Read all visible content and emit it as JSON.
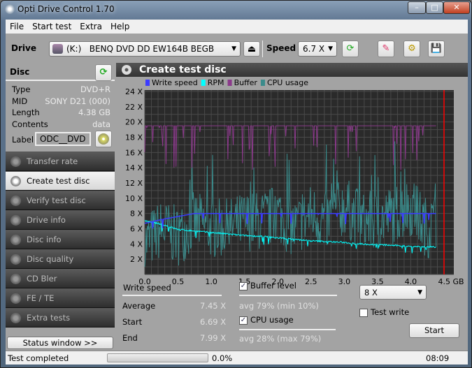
{
  "window": {
    "title": "Opti Drive Control 1.70",
    "min": "–",
    "max": "□",
    "close": "✕"
  },
  "menu": [
    "File",
    "Start test",
    "Extra",
    "Help"
  ],
  "toolbar": {
    "drive_label": "Drive",
    "drive_letter": "(K:)",
    "drive_name": "BENQ DVD DD EW164B BEGB",
    "speed_label": "Speed",
    "speed_value": "6.7 X"
  },
  "disc": {
    "title": "Disc",
    "rows": [
      {
        "k": "Type",
        "v": "DVD+R"
      },
      {
        "k": "MID",
        "v": "SONY D21 (000)"
      },
      {
        "k": "Length",
        "v": "4.38 GB"
      },
      {
        "k": "Contents",
        "v": "data"
      }
    ],
    "label_key": "Label",
    "label_value": "ODC__DVD"
  },
  "nav": [
    {
      "label": "Transfer rate"
    },
    {
      "label": "Create test disc",
      "selected": true
    },
    {
      "label": "Verify test disc"
    },
    {
      "label": "Drive info"
    },
    {
      "label": "Disc info"
    },
    {
      "label": "Disc quality"
    },
    {
      "label": "CD Bler"
    },
    {
      "label": "FE / TE"
    },
    {
      "label": "Extra tests"
    }
  ],
  "status_window_button": "Status window >>",
  "panel_title": "Create test disc",
  "chart_data": {
    "type": "line",
    "legend": [
      {
        "name": "Write speed",
        "color": "#3b3bff"
      },
      {
        "name": "RPM",
        "color": "#00ffff"
      },
      {
        "name": "Buffer",
        "color": "#8b3a8b"
      },
      {
        "name": "CPU usage",
        "color": "#3a8b8b"
      }
    ],
    "legend_placement": "top",
    "x_ticks": [
      "0.0",
      "0.5",
      "1.0",
      "1.5",
      "2.0",
      "2.5",
      "3.0",
      "3.5",
      "4.0",
      "4.5 GB"
    ],
    "y_ticks": [
      "2 X",
      "4 X",
      "6 X",
      "8 X",
      "10 X",
      "12 X",
      "14 X",
      "16 X",
      "18 X",
      "20 X",
      "22 X",
      "24 X"
    ],
    "xlim": [
      0,
      4.5
    ],
    "ylim": [
      0,
      24
    ],
    "grid": true,
    "end_marker_color": "#ff0000",
    "x": [
      0,
      0.25,
      0.5,
      0.75,
      1.0,
      1.25,
      1.5,
      1.75,
      2.0,
      2.25,
      2.5,
      2.75,
      3.0,
      3.25,
      3.5,
      3.75,
      4.0,
      4.25,
      4.38
    ],
    "series": [
      {
        "name": "Write speed",
        "values": [
          6.7,
          7.2,
          7.6,
          8.0,
          8.0,
          8.0,
          8.0,
          8.0,
          8.0,
          8.0,
          8.0,
          8.0,
          8.0,
          8.0,
          8.0,
          8.0,
          8.0,
          8.0,
          8.0
        ]
      },
      {
        "name": "RPM",
        "values": [
          7.0,
          6.6,
          5.9,
          5.7,
          5.5,
          5.3,
          5.1,
          5.0,
          4.8,
          4.6,
          4.4,
          4.3,
          4.2,
          4.0,
          3.9,
          3.8,
          3.7,
          3.6,
          3.6
        ]
      },
      {
        "name": "Buffer",
        "values": [
          19.5,
          19.5,
          19.5,
          19.5,
          19.5,
          19.5,
          19.5,
          19.5,
          19.5,
          19.5,
          19.5,
          19.5,
          19.5,
          19.5,
          19.5,
          19.5,
          19.5,
          19.5,
          19.5
        ]
      },
      {
        "name": "CPU usage",
        "values": [
          4,
          6,
          5,
          7,
          6,
          6,
          7,
          7,
          8,
          6,
          8,
          7,
          9,
          7,
          7,
          8,
          9,
          6,
          7
        ]
      }
    ]
  },
  "stats": {
    "write_speed_title": "Write speed",
    "rows": [
      {
        "k": "Average",
        "v": "7.45 X"
      },
      {
        "k": "Start",
        "v": "6.69 X"
      },
      {
        "k": "End",
        "v": "7.99 X"
      }
    ],
    "buffer_label": "Buffer level",
    "buffer_checked": true,
    "buffer_stat": "avg 79% (min 10%)",
    "cpu_label": "CPU usage",
    "cpu_checked": true,
    "cpu_stat": "avg 28% (max 79%)",
    "write_speed_select": "8 X",
    "test_write_label": "Test write",
    "test_write_checked": false,
    "start_button": "Start"
  },
  "status": {
    "text": "Test completed",
    "progress_text": "0.0%",
    "progress": 0,
    "time": "08:09"
  }
}
